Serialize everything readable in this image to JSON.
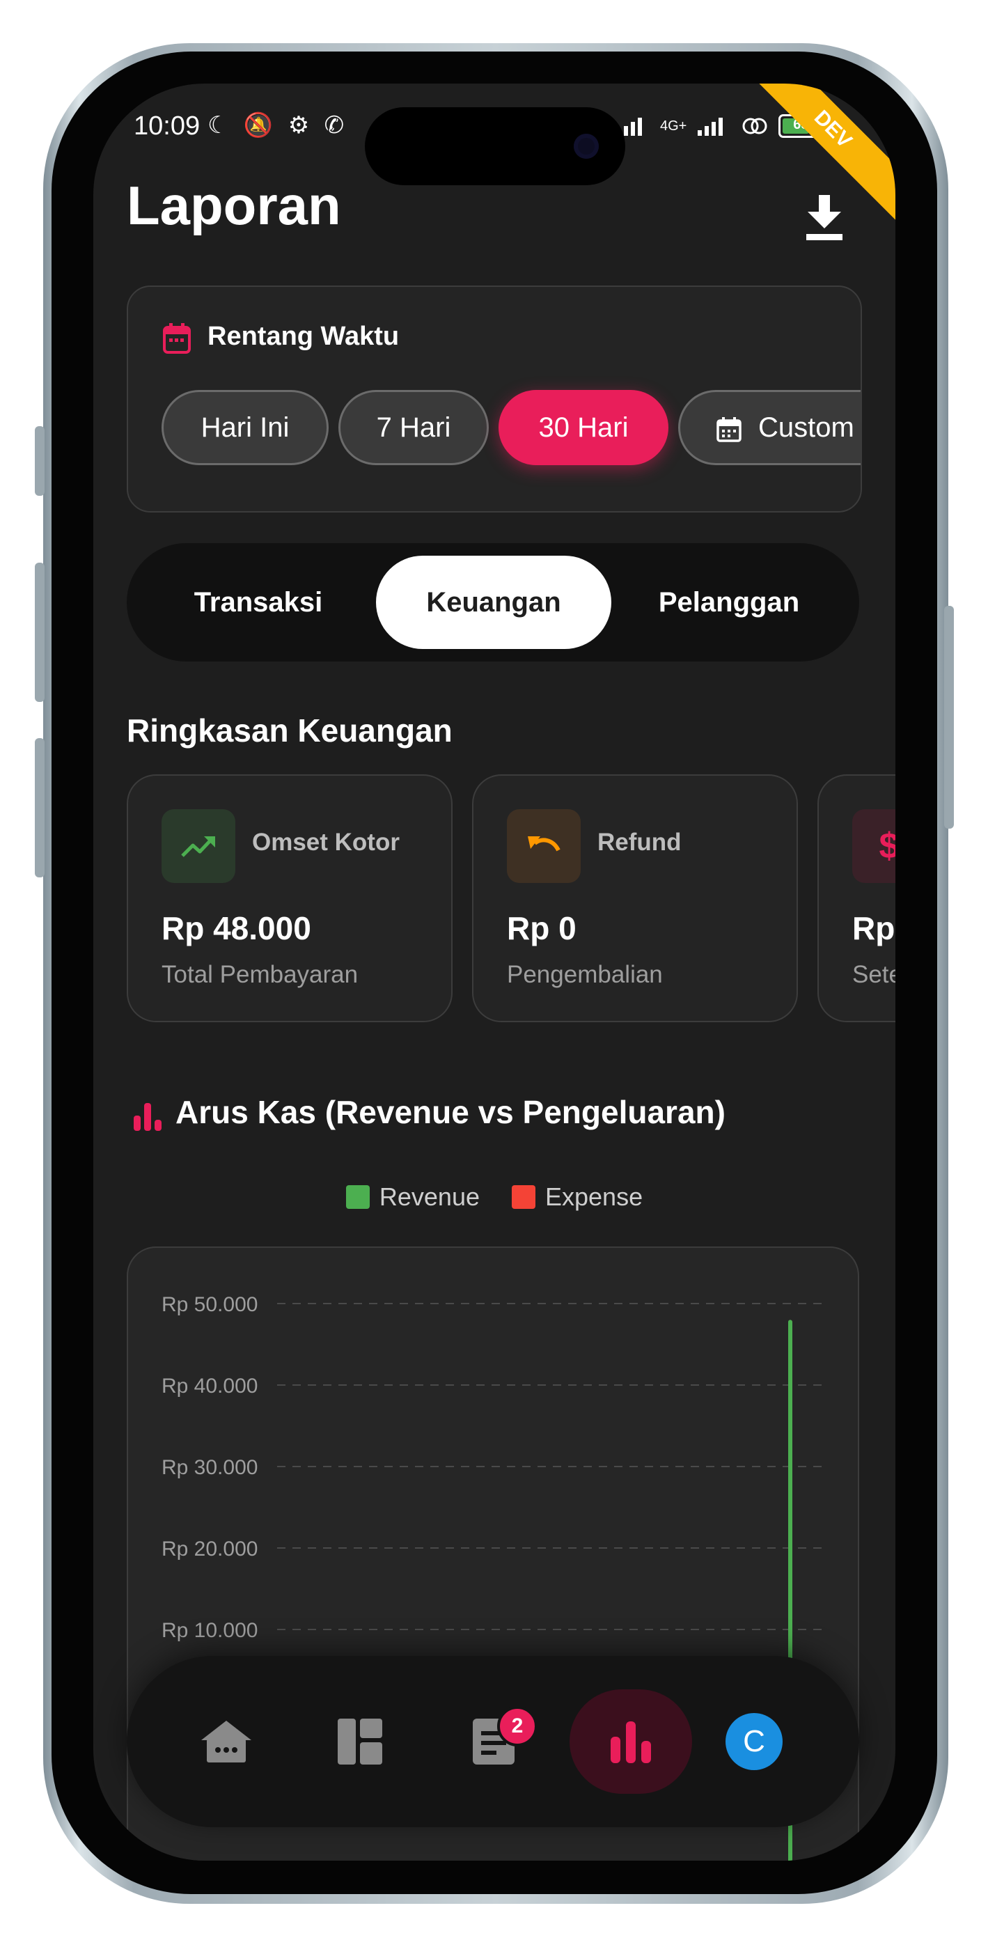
{
  "status_bar": {
    "time": "10:09",
    "network": "4G+",
    "battery": "65",
    "dev_banner": "DEV"
  },
  "header": {
    "title": "Laporan",
    "download_icon": "download-icon"
  },
  "date_range": {
    "title": "Rentang Waktu",
    "chips": [
      "Hari Ini",
      "7 Hari",
      "30 Hari",
      "Custom"
    ],
    "active_chip": "30 Hari"
  },
  "tabs": {
    "items": [
      "Transaksi",
      "Keuangan",
      "Pelanggan"
    ],
    "active": "Keuangan"
  },
  "summary": {
    "title": "Ringkasan Keuangan",
    "cards": [
      {
        "label": "Omset Kotor",
        "value": "Rp 48.000",
        "sub": "Total Pembayaran",
        "icon": "trending-up-icon",
        "color": "#4caf50"
      },
      {
        "label": "Refund",
        "value": "Rp 0",
        "sub": "Pengembalian",
        "icon": "undo-icon",
        "color": "#ff9800"
      },
      {
        "label": "",
        "value": "Rp",
        "sub": "Sete",
        "icon": "dollar-icon",
        "color": "#e91e5a"
      }
    ]
  },
  "cashflow": {
    "title": "Arus Kas (Revenue vs Pengeluaran)",
    "legend": [
      {
        "name": "Revenue",
        "color": "#4caf50"
      },
      {
        "name": "Expense",
        "color": "#f44336"
      }
    ]
  },
  "chart_data": {
    "type": "bar",
    "title": "Arus Kas (Revenue vs Pengeluaran)",
    "y_ticks": [
      "Rp 50.000",
      "Rp 40.000",
      "Rp 30.000",
      "Rp 20.000",
      "Rp 10.000"
    ],
    "ylim": [
      0,
      50000
    ],
    "grid": true,
    "legend_position": "top-center",
    "series": [
      {
        "name": "Revenue",
        "color": "#4caf50",
        "values": [
          48000
        ]
      },
      {
        "name": "Expense",
        "color": "#f44336",
        "values": [
          0
        ]
      }
    ]
  },
  "bottom_nav": {
    "items": [
      "home-icon",
      "dashboard-icon",
      "orders-icon",
      "reports-icon",
      "profile-avatar"
    ],
    "orders_badge": "2",
    "avatar_letter": "C",
    "accent": "#e91e5a"
  }
}
